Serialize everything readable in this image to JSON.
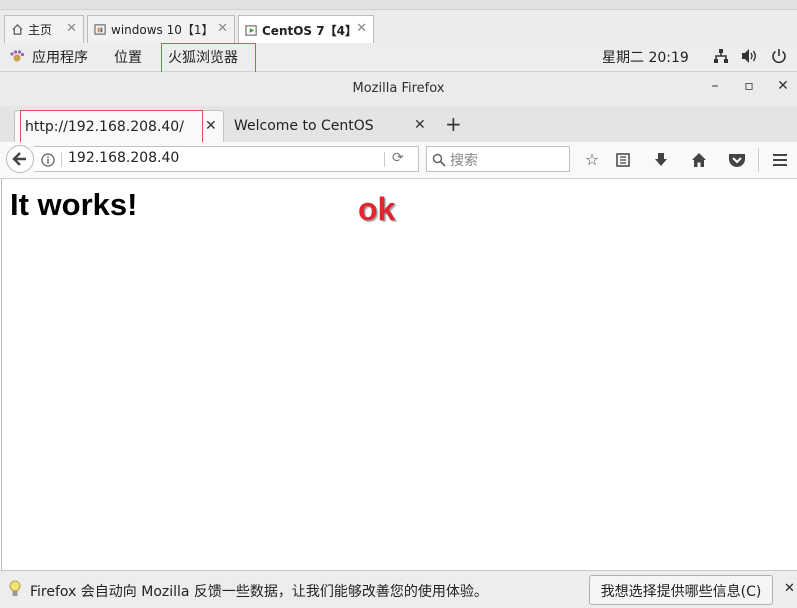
{
  "vm_tabs": [
    {
      "label": "主页",
      "icon": "home-icon"
    },
    {
      "label": "windows 10【1】",
      "icon": "vm-windows-icon"
    },
    {
      "label": "CentOS 7【4】",
      "icon": "vm-play-icon"
    }
  ],
  "gnome_bar": {
    "applications": "应用程序",
    "places": "位置",
    "active_app": "火狐浏览器",
    "clock": "星期二 20:19"
  },
  "window": {
    "title": "Mozilla Firefox",
    "minimize": "–",
    "maximize": "▫",
    "close": "✕"
  },
  "browser_tabs": [
    {
      "title": "http://192.168.208.40/",
      "close": "✕"
    },
    {
      "title": "Welcome to CentOS",
      "close": "✕"
    }
  ],
  "new_tab": "+",
  "nav": {
    "url": "192.168.208.40",
    "search_placeholder": "搜索"
  },
  "page": {
    "heading": "It works!",
    "stamp": "ok"
  },
  "notification": {
    "message": "Firefox 会自动向 Mozilla 反馈一些数据，让我们能够改善您的使用体验。",
    "button": "我想选择提供哪些信息(C)",
    "close": "✕"
  },
  "colors": {
    "highlight_box": "#d9534f",
    "ok_stamp": "#e3262e"
  }
}
